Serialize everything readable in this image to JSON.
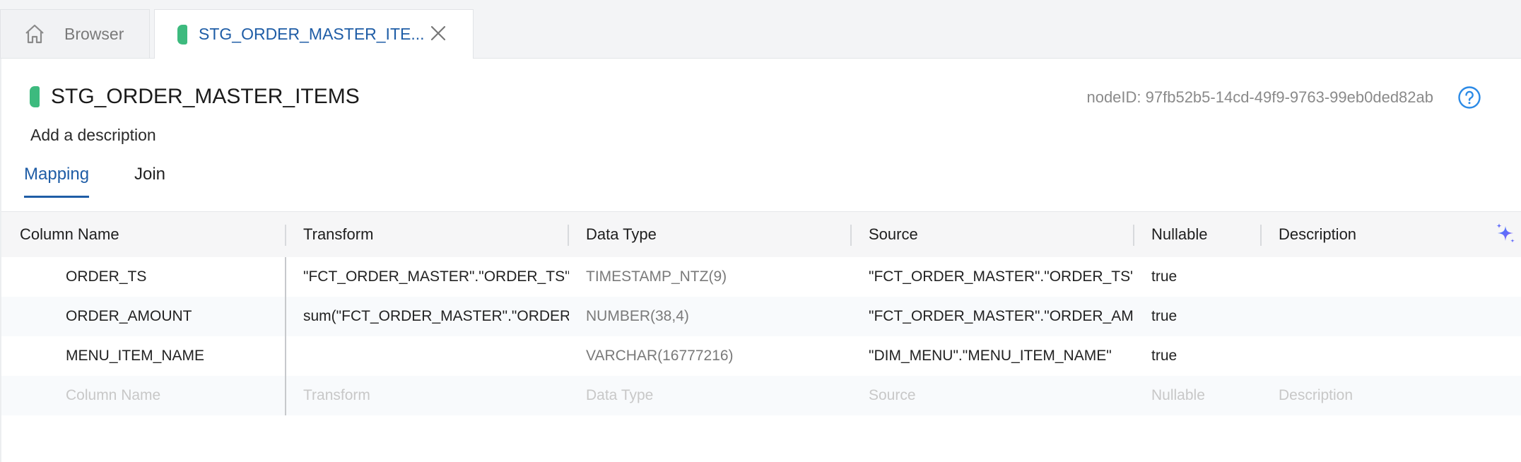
{
  "tabs": {
    "browser_label": "Browser",
    "active_label": "STG_ORDER_MASTER_ITE..."
  },
  "node": {
    "title": "STG_ORDER_MASTER_ITEMS",
    "node_id": "nodeID: 97fb52b5-14cd-49f9-9763-99eb0ded82ab",
    "description_placeholder": "Add a description",
    "color": "#3dba7e"
  },
  "subtabs": {
    "mapping": "Mapping",
    "join": "Join"
  },
  "grid": {
    "headers": [
      "Column Name",
      "Transform",
      "Data Type",
      "Source",
      "Nullable",
      "Description"
    ],
    "rows": [
      {
        "name": "ORDER_TS",
        "transform": "\"FCT_ORDER_MASTER\".\"ORDER_TS\"::d",
        "type": "TIMESTAMP_NTZ(9)",
        "source": "\"FCT_ORDER_MASTER\".\"ORDER_TS\"",
        "nullable": "true",
        "description": ""
      },
      {
        "name": "ORDER_AMOUNT",
        "transform": "sum(\"FCT_ORDER_MASTER\".\"ORDER_A",
        "type": "NUMBER(38,4)",
        "source": "\"FCT_ORDER_MASTER\".\"ORDER_AMOU",
        "nullable": "true",
        "description": ""
      },
      {
        "name": "MENU_ITEM_NAME",
        "transform": "",
        "type": "VARCHAR(16777216)",
        "source": "\"DIM_MENU\".\"MENU_ITEM_NAME\"",
        "nullable": "true",
        "description": ""
      }
    ],
    "placeholder_row": {
      "name": "Column Name",
      "transform": "Transform",
      "type": "Data Type",
      "source": "Source",
      "nullable": "Nullable",
      "description": "Description"
    }
  },
  "icons": {
    "home": "home-icon",
    "close": "close-icon",
    "help": "help-circle-icon",
    "ai": "sparkle-icon"
  },
  "colors": {
    "accent": "#1f5da6",
    "node": "#3dba7e",
    "sparkle": "#4f6ef7"
  }
}
